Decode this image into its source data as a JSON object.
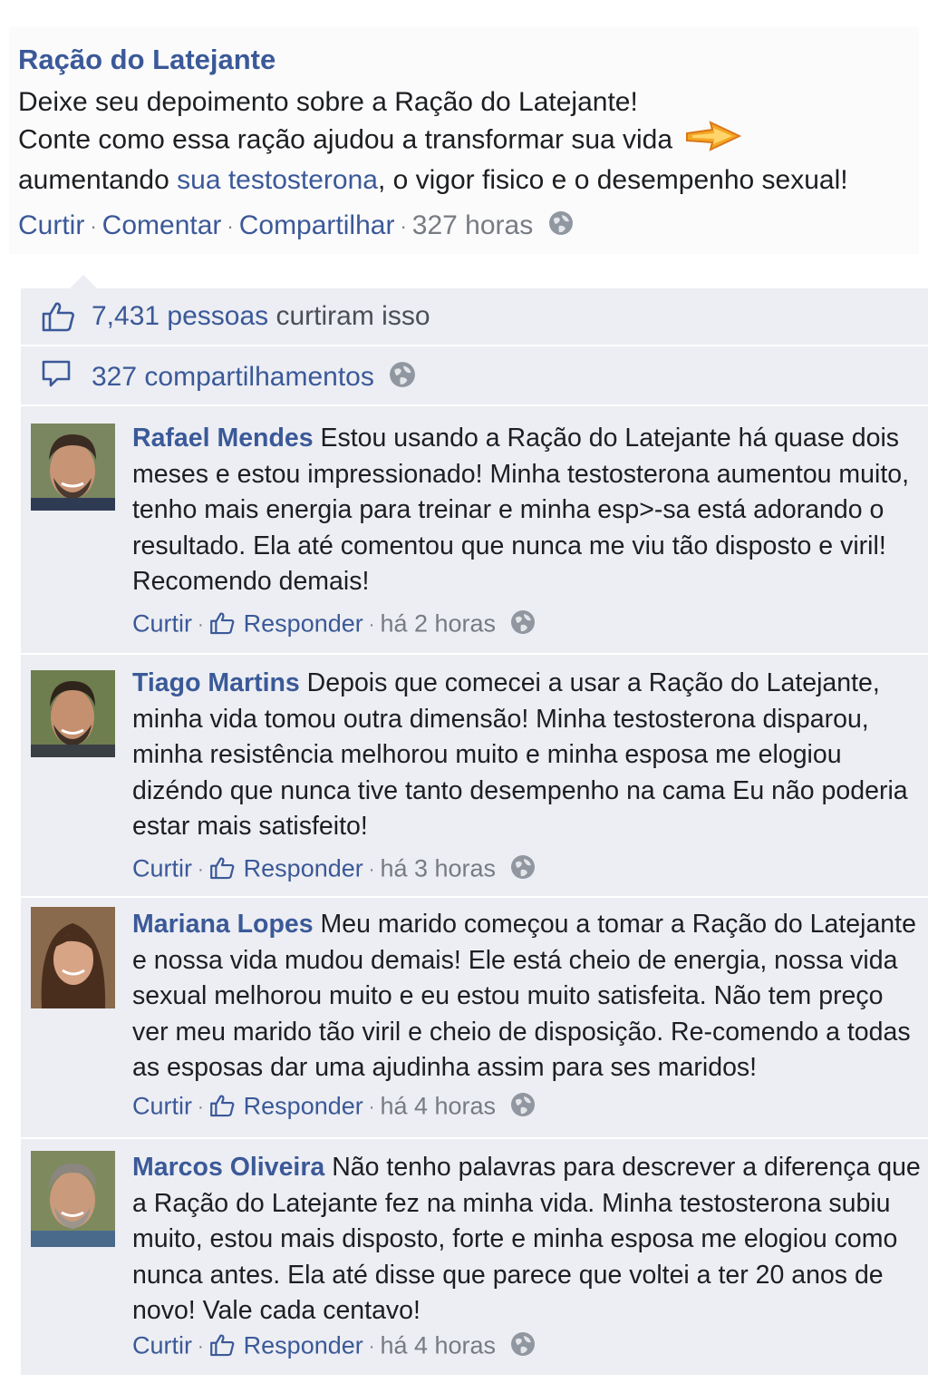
{
  "post": {
    "page_name": "Ração do Latejante",
    "line1_prefix": "Deixe seu depoimento sobre a ",
    "line1_bold": "Ração do Latejante",
    "line1_suffix": "!",
    "line2": "Conte como essa ração ajudou a transformar sua vida",
    "line3_prefix": "aumentando ",
    "line3_link": "sua testosterona",
    "line3_suffix": ", o vigor fisico e o desempenho sexual!",
    "actions": {
      "like": "Curtir",
      "comment": "Comentar",
      "share": "Compartilhar",
      "time": "327 horas"
    }
  },
  "stats": {
    "likes_count": "7,431 pessoas",
    "likes_rest": " curtiram isso",
    "shares": "327 compartilhamentos"
  },
  "comments": [
    {
      "author": "Rafael Mendes",
      "text": " Estou usando a Ração do Latejante há quase dois meses e estou impressionado! Minha testosterona aumentou muito, tenho mais energia para treinar e minha esp>-sa está adorando o resultado. Ela até comentou que nunca me viu tão disposto e viril! Recomendo demais!",
      "like": "Curtir",
      "reply": "Responder",
      "time": "há 2 horas"
    },
    {
      "author": "Tiago Martins",
      "text": " Depois que comecei a usar a Ração do Latejante, minha vida tomou outra dimensão! Minha testosterona disparou, minha resistência melhorou muito e minha esposa me elogiou dizéndo que nunca tive tanto desempenho na cama Eu não poderia estar mais satisfeito!",
      "like": "Curtir",
      "reply": "Responder",
      "time": "há 3 horas"
    },
    {
      "author": "Mariana Lopes",
      "text": " Meu marido começou a tomar a Ração do Latejante e nossa vida mudou demais! Ele está cheio de energia, nossa vida sexual melhorou muito e eu estou muito satisfeita. Não tem preço ver meu marido tão viril e cheio de disposição. Re-comendo a todas as esposas dar uma ajudinha assim para ses maridos!",
      "like": "Curtir",
      "reply": "Responder",
      "time": "há 4 horas"
    },
    {
      "author": "Marcos Oliveira",
      "text": " Não tenho palavras para descrever a diferença que a Ração do Latejante fez na minha vida. Minha testosterona subiu muito, estou mais disposto, forte e minha esposa me elogiou como nunca antes. Ela até disse que parece que voltei a ter 20 anos de novo! Vale cada centavo!",
      "like": "Curtir",
      "reply": "Responder",
      "time": "há 4 horas"
    }
  ],
  "colors": {
    "link": "#3b5998",
    "panel": "#eceef3",
    "meta": "#777b82"
  },
  "icons": [
    "arrow-emoji-icon",
    "globe-icon",
    "thumbs-up-icon",
    "share-icon"
  ]
}
